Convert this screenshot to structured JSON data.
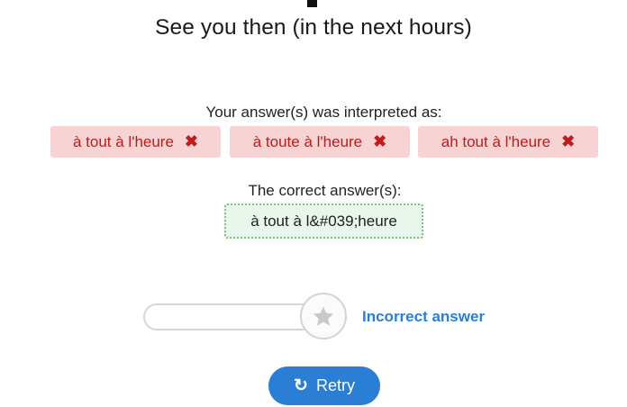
{
  "prompt": "See you then (in the next hours)",
  "interpretation": {
    "label": "Your answer(s) was interpreted as:",
    "answers": [
      "à tout à l'heure",
      "à toute à l'heure",
      "ah tout à l'heure"
    ],
    "remove_icon": "✖"
  },
  "correct": {
    "label": "The correct answer(s):",
    "answer": "à tout à l&#039;heure"
  },
  "result": {
    "text": "Incorrect answer",
    "progress": 0
  },
  "retry": {
    "label": "Retry",
    "icon": "↻"
  },
  "colors": {
    "accent": "#2a7fd4",
    "error_bg": "#f8d3d3",
    "error_text": "#b51e1e",
    "success_bg": "#e9f6ec",
    "success_border": "#7bbf8a"
  }
}
